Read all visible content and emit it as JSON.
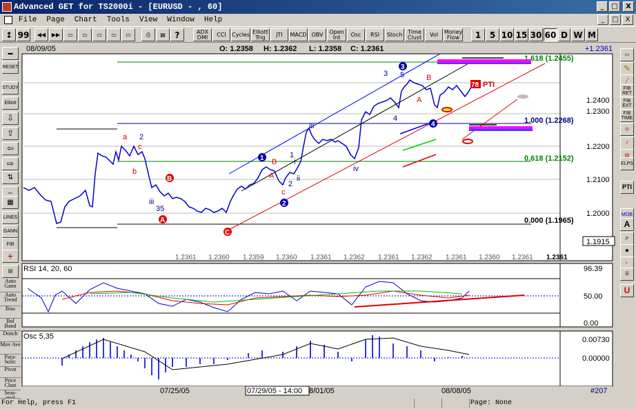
{
  "window": {
    "title": "Advanced GET for TS2000i - [EURUSD - , 60]",
    "buttons": [
      "_",
      "□",
      "X"
    ]
  },
  "menu": [
    "File",
    "Page",
    "Chart",
    "Tools",
    "View",
    "Window",
    "Help"
  ],
  "toolbar": {
    "studies": [
      "ADX DMI",
      "CCI",
      "Cycles",
      "Elliott Trig",
      "JTI",
      "MACD",
      "OBV",
      "Open Int",
      "Osc",
      "RSI",
      "Stoch",
      "Time Clust",
      "Vol",
      "Money Flow"
    ],
    "intervals": [
      "1",
      "5",
      "10",
      "15",
      "30",
      "60",
      "D",
      "W",
      "M"
    ],
    "active_interval": "60"
  },
  "left_tools": [
    "RESET",
    "STUDY",
    "Elliott",
    "LINES",
    "GANN",
    "FIB"
  ],
  "left_side_labels": [
    "Auto Gann",
    "Auto Trend",
    "Bias",
    "Bol Band",
    "Donch",
    "Mov Ave",
    "Para- bolic",
    "Pivot",
    "Price Clust",
    "Seas- onal"
  ],
  "right_tools": [
    "FIB RET",
    "FIB EXT",
    "FIB TIME",
    "ELPS",
    "PTI",
    "MOB",
    "A"
  ],
  "chart": {
    "date": "08/09/05",
    "ohlc": {
      "o": "O: 1.2358",
      "h": "H: 1.2362",
      "l": "L: 1.2358",
      "c": "C: 1.2361"
    },
    "last_price": "+1.2361",
    "price_ticks": [
      "1.2400",
      "1.2300",
      "1.2200",
      "1.2100",
      "1.2000"
    ],
    "low_price_box": "1.1915",
    "fib_levels": [
      {
        "label": "1.618 (1.2455)",
        "value": 1.2455
      },
      {
        "label": "1.000 (1.2268)",
        "value": 1.2268
      },
      {
        "label": "0.618 (1.2152)",
        "value": 1.2152
      },
      {
        "label": "0.000 (1.1965)",
        "value": 1.1965
      }
    ],
    "pti_value": "78",
    "pti_label": "PTI",
    "ticker_row": [
      "1.2361",
      "1.2360",
      "1.2359",
      "1.2360",
      "1.2361",
      "1.2362",
      "1.2361",
      "1.2362",
      "1.2361",
      "1.2360",
      "1.2361",
      "1.2361"
    ],
    "wave_labels": {
      "black": [
        "a",
        "b",
        "c",
        "iii",
        "35",
        "iii",
        "iv",
        "1",
        "2",
        "3",
        "4",
        "5",
        "ii",
        "i",
        "2"
      ],
      "red": [
        "B",
        "A",
        "C",
        "A",
        "B",
        "c",
        "B",
        "A"
      ],
      "circled": [
        "1",
        "2",
        "3",
        "4"
      ]
    }
  },
  "rsi": {
    "title": "RSI 14, 20, 60",
    "ticks": [
      "96.39",
      "50.00",
      "0.00"
    ]
  },
  "osc": {
    "title": "Osc 5,35",
    "ticks": [
      "0.00730",
      "0.00000"
    ]
  },
  "dates": [
    "07/25/05",
    "07/29/05 - 14:00",
    "8/01/05",
    "08/08/05"
  ],
  "bar_count": "#207",
  "status": {
    "help": "For Help, press F1",
    "page": "Page: None"
  },
  "colors": {
    "price": "#0000cc",
    "fib": "#008000",
    "channel": "#0000ff",
    "trend": "#e00000"
  }
}
